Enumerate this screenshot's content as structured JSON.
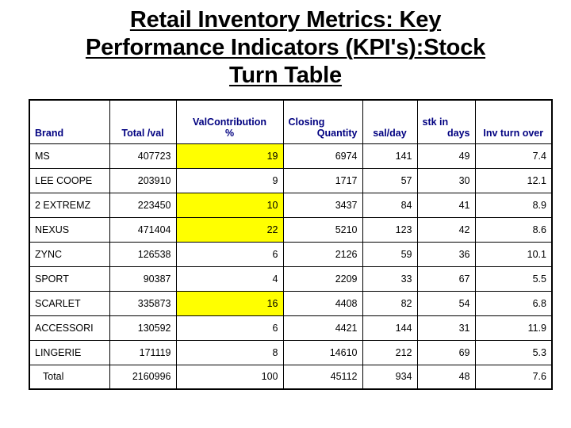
{
  "title": {
    "line1": "Retail Inventory Metrics: Key",
    "line2": "Performance Indicators (KPI's):Stock",
    "line3": "Turn Table"
  },
  "table": {
    "headers": {
      "brand": "Brand",
      "total_val": "Total /val",
      "val_contribution_l1": "ValContribution",
      "val_contribution_l2": "%",
      "closing_l1": "Closing",
      "closing_l2": "Quantity",
      "sal_per_day": "sal/day",
      "stk_in_days_l1": "stk in",
      "stk_in_days_l2": "days",
      "inv_turn_over": "Inv turn over"
    },
    "highlight_color": "#FFFF00",
    "highlight_text_color": "#C07000",
    "header_text_color": "#000080",
    "rows": [
      {
        "brand": "MS",
        "total_val": "407723",
        "val_contribution": "19",
        "closing_quantity": "6974",
        "sal_per_day": "141",
        "stk_in_days": "49",
        "inv_turn_over": "7.4",
        "highlight": true
      },
      {
        "brand": "LEE COOPE",
        "total_val": "203910",
        "val_contribution": "9",
        "closing_quantity": "1717",
        "sal_per_day": "57",
        "stk_in_days": "30",
        "inv_turn_over": "12.1",
        "highlight": false
      },
      {
        "brand": "2 EXTREMZ",
        "total_val": "223450",
        "val_contribution": "10",
        "closing_quantity": "3437",
        "sal_per_day": "84",
        "stk_in_days": "41",
        "inv_turn_over": "8.9",
        "highlight": true
      },
      {
        "brand": "NEXUS",
        "total_val": "471404",
        "val_contribution": "22",
        "closing_quantity": "5210",
        "sal_per_day": "123",
        "stk_in_days": "42",
        "inv_turn_over": "8.6",
        "highlight": true
      },
      {
        "brand": "ZYNC",
        "total_val": "126538",
        "val_contribution": "6",
        "closing_quantity": "2126",
        "sal_per_day": "59",
        "stk_in_days": "36",
        "inv_turn_over": "10.1",
        "highlight": false
      },
      {
        "brand": "SPORT",
        "total_val": "90387",
        "val_contribution": "4",
        "closing_quantity": "2209",
        "sal_per_day": "33",
        "stk_in_days": "67",
        "inv_turn_over": "5.5",
        "highlight": false
      },
      {
        "brand": "SCARLET",
        "total_val": "335873",
        "val_contribution": "16",
        "closing_quantity": "4408",
        "sal_per_day": "82",
        "stk_in_days": "54",
        "inv_turn_over": "6.8",
        "highlight": true
      },
      {
        "brand": "ACCESSORI",
        "total_val": "130592",
        "val_contribution": "6",
        "closing_quantity": "4421",
        "sal_per_day": "144",
        "stk_in_days": "31",
        "inv_turn_over": "11.9",
        "highlight": false
      },
      {
        "brand": "LINGERIE",
        "total_val": "171119",
        "val_contribution": "8",
        "closing_quantity": "14610",
        "sal_per_day": "212",
        "stk_in_days": "69",
        "inv_turn_over": "5.3",
        "highlight": false
      },
      {
        "brand": "Total",
        "total_val": "2160996",
        "val_contribution": "100",
        "closing_quantity": "45112",
        "sal_per_day": "934",
        "stk_in_days": "48",
        "inv_turn_over": "7.6",
        "highlight": false,
        "is_total": true
      }
    ]
  }
}
